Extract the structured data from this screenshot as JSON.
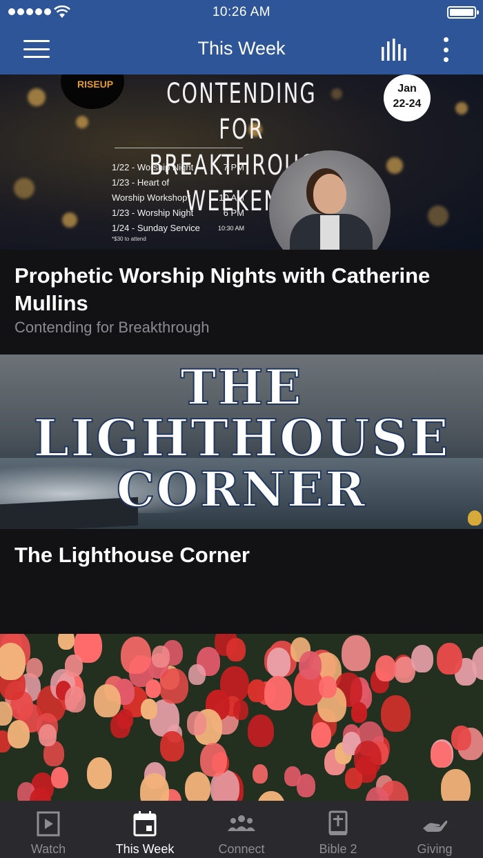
{
  "status_bar": {
    "time": "10:26 AM"
  },
  "header": {
    "title": "This Week"
  },
  "cards": [
    {
      "title": "Prophetic Worship Nights with Catherine Mullins",
      "subtitle": "Contending for Breakthrough",
      "image": {
        "logo_text": "RISEUP",
        "headline_1": "CONTENDING FOR",
        "headline_2": "BREAKTHROUGH WEEKEND",
        "date_1": "Jan",
        "date_2": "22-24",
        "schedule": [
          {
            "label": "1/22 - Worship Night",
            "time": "7 PM"
          },
          {
            "label": "1/23 - Heart of",
            "time": ""
          },
          {
            "label": "Worship Workshop*",
            "time": "10 AM"
          },
          {
            "label": "1/23 - Worship Night",
            "time": "6 PM"
          },
          {
            "label": "1/24 - Sunday Service",
            "time": "10:30 AM"
          }
        ],
        "footnote": "*$30 to attend"
      }
    },
    {
      "title": "The Lighthouse Corner",
      "subtitle": "",
      "image": {
        "line_1": "THE",
        "line_2": "LIGHTHOUSE",
        "line_3": "CORNER"
      }
    },
    {
      "title": "",
      "subtitle": ""
    }
  ],
  "tabs": [
    {
      "label": "Watch",
      "icon": "play-icon",
      "active": false
    },
    {
      "label": "This Week",
      "icon": "calendar-icon",
      "active": true
    },
    {
      "label": "Connect",
      "icon": "people-icon",
      "active": false
    },
    {
      "label": "Bible 2",
      "icon": "bible-icon",
      "active": false
    },
    {
      "label": "Giving",
      "icon": "hand-icon",
      "active": false
    }
  ],
  "colors": {
    "header_bg": "#2d5597",
    "background": "#121214",
    "tabbar_bg": "#2a2a2e",
    "tab_inactive": "#8d8d93",
    "tab_active": "#ffffff",
    "subtitle": "#8c8c90"
  }
}
